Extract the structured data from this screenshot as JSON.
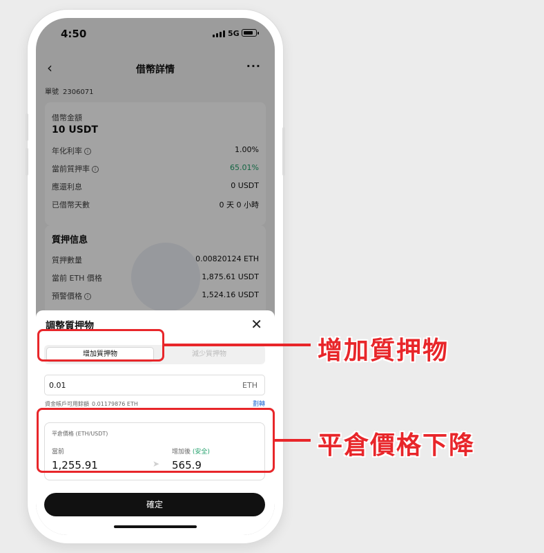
{
  "status_bar": {
    "time": "4:50",
    "network": "5G"
  },
  "nav": {
    "title": "借幣詳情",
    "back_icon": "chevron-left-icon",
    "more_icon": "more-icon"
  },
  "order": {
    "label": "單號",
    "number": "2306071"
  },
  "loan_card": {
    "amount_label": "借幣金額",
    "amount": "10 USDT",
    "rows": [
      {
        "label": "年化利率",
        "value": "1.00%"
      },
      {
        "label": "當前質押率",
        "value": "65.01%"
      },
      {
        "label": "應還利息",
        "value": "0 USDT"
      },
      {
        "label": "已借幣天數",
        "value": "0 天 0 小時"
      }
    ]
  },
  "collateral_card": {
    "title": "質押信息",
    "rows": [
      {
        "label": "質押數量",
        "value": "0.00820124 ETH"
      },
      {
        "label": "當前 ETH 價格",
        "value": "1,875.61 USDT"
      },
      {
        "label": "預警價格",
        "value": "1,524.16 USDT"
      }
    ]
  },
  "sheet": {
    "title": "調整質押物",
    "close_icon": "close-icon",
    "tab_active": "增加質押物",
    "tab_inactive": "減少質押物",
    "amount_value": "0.01",
    "amount_unit": "ETH",
    "available_label": "資金帳戶可用餘額",
    "available_value": "0.01179876 ETH",
    "transfer_label": "劃轉",
    "liquidation_title": "平倉價格 (ETH/USDT)",
    "current_label": "當前",
    "current_value": "1,255.91",
    "after_label": "增加後",
    "after_status": "(安全)",
    "after_value": "565.9",
    "confirm_label": "確定"
  },
  "annotations": {
    "callout_1": "增加質押物",
    "callout_2": "平倉價格下降",
    "color": "#e8262a"
  },
  "colors": {
    "accent_green": "#22a06b",
    "link_blue": "#2a6fd6",
    "button_dark": "#111111"
  }
}
